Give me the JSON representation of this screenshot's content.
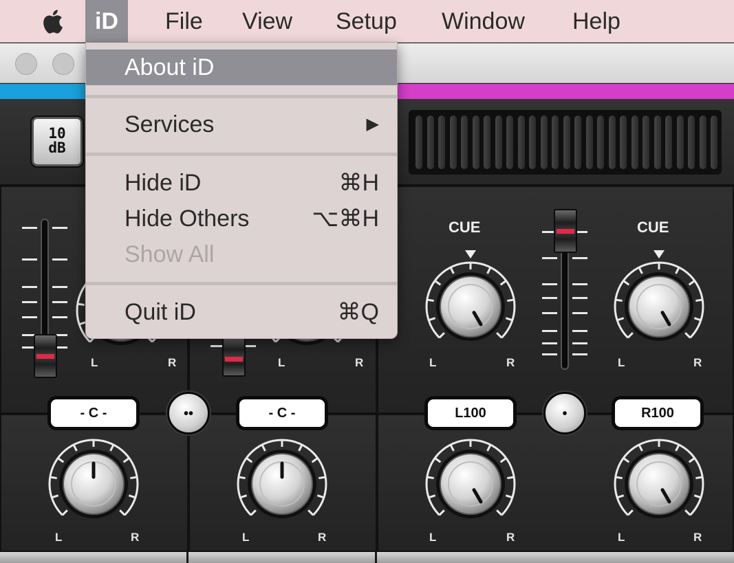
{
  "menubar": {
    "apple_icon": "apple-logo",
    "items": [
      "iD",
      "File",
      "View",
      "Setup",
      "Window",
      "Help"
    ],
    "active": "iD"
  },
  "app_menu": {
    "items": [
      {
        "label": "About iD",
        "shortcut": "",
        "highlighted": true,
        "enabled": true
      },
      {
        "label": "Services",
        "shortcut": "▶",
        "highlighted": false,
        "enabled": true,
        "submenu": true
      },
      {
        "label": "Hide iD",
        "shortcut": "⌘H",
        "highlighted": false,
        "enabled": true
      },
      {
        "label": "Hide Others",
        "shortcut": "⌥⌘H",
        "highlighted": false,
        "enabled": true
      },
      {
        "label": "Show All",
        "shortcut": "",
        "highlighted": false,
        "enabled": false
      },
      {
        "label": "Quit iD",
        "shortcut": "⌘Q",
        "highlighted": false,
        "enabled": true
      }
    ]
  },
  "window": {
    "controls": [
      "close",
      "minimize"
    ]
  },
  "mixer": {
    "pad_button": {
      "line1": "10",
      "line2": "dB"
    },
    "cue_label": "CUE",
    "left_label": "L",
    "right_label": "R",
    "channels": [
      {
        "pan": "- C -"
      },
      {
        "pan": "- C -"
      },
      {
        "pan": "L100"
      },
      {
        "pan": "R100"
      }
    ],
    "link_buttons": [
      {
        "symbol": "••",
        "state": "unlinked"
      },
      {
        "symbol": "•",
        "state": "linked"
      }
    ],
    "colors": {
      "accent_blue": "#1aa0dc",
      "accent_pink": "#d43fc9",
      "fader_red": "#e02a46"
    }
  }
}
